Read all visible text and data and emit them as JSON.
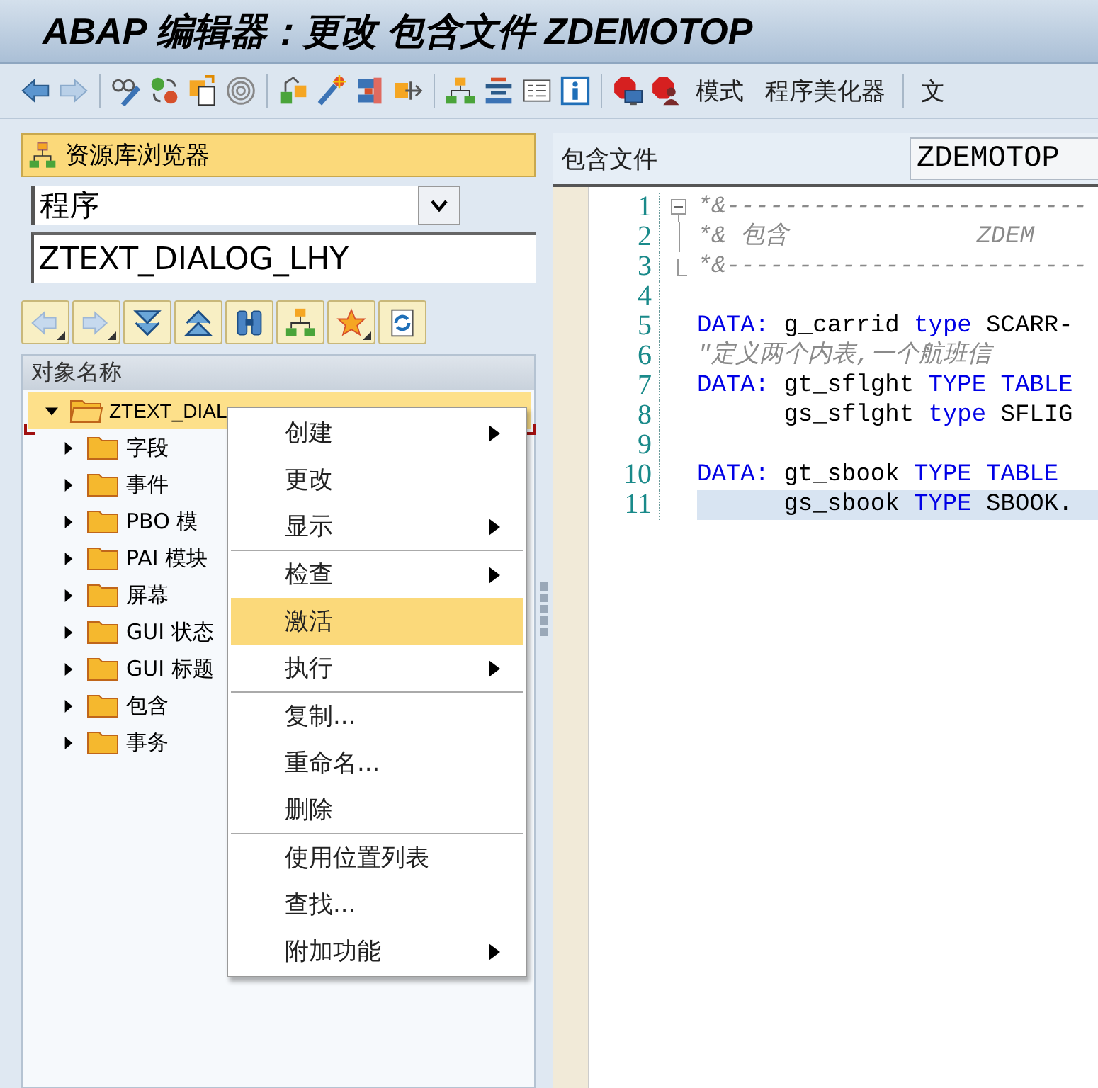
{
  "window": {
    "title": "ABAP 编辑器：更改 包含文件 ZDEMOTOP"
  },
  "toolbar": {
    "text_buttons": [
      "模式",
      "程序美化器"
    ],
    "cut_button": "文"
  },
  "repository_browser": {
    "title": "资源库浏览器",
    "object_type": "程序",
    "object_name": "ZTEXT_DIALOG_LHY",
    "tree": {
      "header": "对象名称",
      "items": [
        {
          "label": "ZTEXT_DIAL",
          "selected": true,
          "expanded": true,
          "children": [
            {
              "label": "字段",
              "selected": false,
              "expanded": false
            },
            {
              "label": "事件",
              "selected": false,
              "expanded": false
            },
            {
              "label": "PBO 模",
              "selected": false,
              "expanded": false
            },
            {
              "label": "PAI 模块",
              "selected": false,
              "expanded": false
            },
            {
              "label": "屏幕",
              "selected": false,
              "expanded": false
            },
            {
              "label": "GUI 状态",
              "selected": false,
              "expanded": false
            },
            {
              "label": "GUI 标题",
              "selected": false,
              "expanded": false
            },
            {
              "label": "包含",
              "selected": false,
              "expanded": false
            },
            {
              "label": "事务",
              "selected": false,
              "expanded": false
            }
          ]
        }
      ]
    }
  },
  "context_menu": {
    "items": [
      {
        "label": "创建",
        "submenu": true,
        "separator_before": false,
        "selected": false
      },
      {
        "label": "更改",
        "submenu": false,
        "separator_before": false,
        "selected": false
      },
      {
        "label": "显示",
        "submenu": true,
        "separator_before": false,
        "selected": false
      },
      {
        "label": "检查",
        "submenu": true,
        "separator_before": true,
        "selected": false
      },
      {
        "label": "激活",
        "submenu": false,
        "separator_before": false,
        "selected": true
      },
      {
        "label": "执行",
        "submenu": true,
        "separator_before": false,
        "selected": false
      },
      {
        "label": "复制...",
        "submenu": false,
        "separator_before": true,
        "selected": false
      },
      {
        "label": "重命名...",
        "submenu": false,
        "separator_before": false,
        "selected": false
      },
      {
        "label": "删除",
        "submenu": false,
        "separator_before": false,
        "selected": false
      },
      {
        "label": "使用位置列表",
        "submenu": false,
        "separator_before": true,
        "selected": false
      },
      {
        "label": "查找...",
        "submenu": false,
        "separator_before": false,
        "selected": false
      },
      {
        "label": "附加功能",
        "submenu": true,
        "separator_before": false,
        "selected": false
      }
    ]
  },
  "editor": {
    "include_label": "包含文件",
    "include_name": "ZDEMOTOP",
    "lines": [
      {
        "number": "1",
        "current": false,
        "kind": "fold_start",
        "tokens": [
          {
            "kind": "comment",
            "text": "*&-------------------------"
          }
        ]
      },
      {
        "number": "2",
        "current": false,
        "kind": "fold_line",
        "tokens": [
          {
            "kind": "comment",
            "text": "*& 包含             ZDEM"
          }
        ]
      },
      {
        "number": "3",
        "current": false,
        "kind": "fold_end",
        "tokens": [
          {
            "kind": "comment",
            "text": "*&-------------------------"
          }
        ]
      },
      {
        "number": "4",
        "current": false
      },
      {
        "number": "5",
        "current": false,
        "tokens": [
          {
            "kind": "keyword",
            "text": "DATA:"
          },
          {
            "kind": "text",
            "text": " g_carrid "
          },
          {
            "kind": "keyword",
            "text": "type"
          },
          {
            "kind": "text",
            "text": " SCARR-"
          }
        ]
      },
      {
        "number": "6",
        "current": false,
        "tokens": [
          {
            "kind": "comment",
            "text": "\"定义两个内表,一个航班信"
          }
        ]
      },
      {
        "number": "7",
        "current": false,
        "tokens": [
          {
            "kind": "keyword",
            "text": "DATA:"
          },
          {
            "kind": "text",
            "text": " gt_sflght "
          },
          {
            "kind": "keyword",
            "text": "TYPE TABLE"
          }
        ]
      },
      {
        "number": "8",
        "current": false,
        "tokens": [
          {
            "kind": "text",
            "text": "      gs_sflght "
          },
          {
            "kind": "keyword",
            "text": "type"
          },
          {
            "kind": "text",
            "text": " SFLIG"
          }
        ]
      },
      {
        "number": "9",
        "current": false
      },
      {
        "number": "10",
        "current": false,
        "tokens": [
          {
            "kind": "keyword",
            "text": "DATA:"
          },
          {
            "kind": "text",
            "text": " gt_sbook "
          },
          {
            "kind": "keyword",
            "text": "TYPE TABLE"
          }
        ]
      },
      {
        "number": "11",
        "current": true,
        "tokens": [
          {
            "kind": "text",
            "text": "      gs_sbook "
          },
          {
            "kind": "keyword",
            "text": "TYPE"
          },
          {
            "kind": "text",
            "text": " SBOOK."
          }
        ]
      }
    ]
  }
}
